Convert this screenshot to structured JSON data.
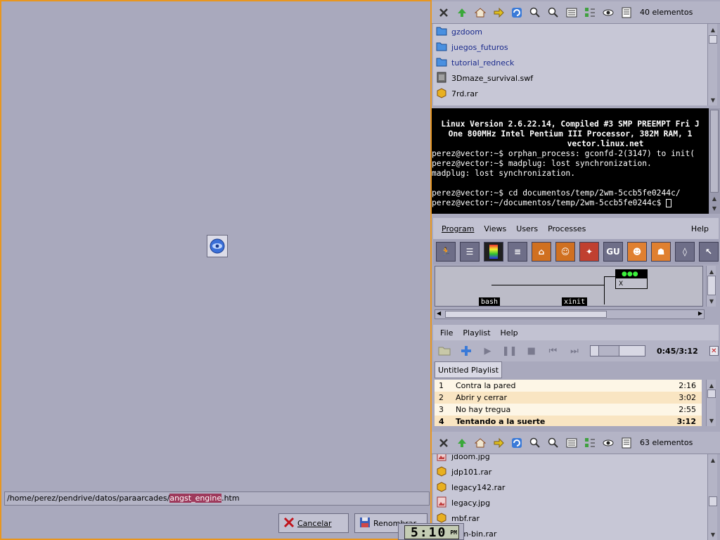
{
  "dialog": {
    "path_prefix": "/home/perez/pendrive/datos/paraarcades/",
    "path_selected": "angst_engine",
    "path_suffix": ".htm",
    "cancel_label": "Cancelar",
    "rename_label": "Renombrar"
  },
  "file_manager_top": {
    "count": "40 elementos",
    "items": [
      {
        "name": "gzdoom",
        "type": "folder"
      },
      {
        "name": "juegos_futuros",
        "type": "folder"
      },
      {
        "name": "tutorial_redneck",
        "type": "folder"
      },
      {
        "name": "3Dmaze_survival.swf",
        "type": "swf"
      },
      {
        "name": "7rd.rar",
        "type": "rar"
      }
    ]
  },
  "terminal": {
    "banner1": "Linux Version 2.6.22.14, Compiled #3 SMP PREEMPT Fri J",
    "banner2": "One 800MHz Intel Pentium III Processor, 382M RAM, 1",
    "banner3": "vector.linux.net",
    "line1": "perez@vector:~$ orphan_process: gconfd-2(3147) to init(",
    "line2": "perez@vector:~$ madplug: lost synchronization.",
    "line3": "madplug: lost synchronization.",
    "line4": "",
    "line5": "perez@vector:~$ cd documentos/temp/2wm-5ccb5fe0244c/",
    "line6": "perez@vector:~/documentos/temp/2wm-5ccb5fe0244c$ "
  },
  "process_viewer": {
    "menu": [
      "Program",
      "Views",
      "Users",
      "Processes"
    ],
    "help": "Help",
    "processes": [
      "bash",
      "xinit",
      "X"
    ]
  },
  "audio_player": {
    "menu": [
      "File",
      "Playlist",
      "Help"
    ],
    "time": "0:45/3:12",
    "seek_fraction": 0.234,
    "playlist_tab": "Untitled Playlist",
    "tracks": [
      {
        "num": "1",
        "title": "Contra la pared",
        "length": "2:16"
      },
      {
        "num": "2",
        "title": "Abrir y cerrar",
        "length": "3:02"
      },
      {
        "num": "3",
        "title": "No hay tregua",
        "length": "2:55"
      },
      {
        "num": "4",
        "title": "Tentando a la suerte",
        "length": "3:12"
      }
    ]
  },
  "file_manager_bottom": {
    "count": "63 elementos",
    "items": [
      {
        "name": "jdoom.jpg",
        "type": "jpg"
      },
      {
        "name": "jdp101.rar",
        "type": "rar"
      },
      {
        "name": "legacy142.rar",
        "type": "rar"
      },
      {
        "name": "legacy.jpg",
        "type": "jpg"
      },
      {
        "name": "mbf.rar",
        "type": "rar"
      },
      {
        "name": "oom-bin.rar",
        "type": "rar"
      }
    ]
  },
  "clock": {
    "time": "5:10",
    "ampm": "PM"
  },
  "colors": {
    "accent_border": "#e8961f",
    "selection": "#9e3a5c",
    "desktop": "#a9a9bd"
  }
}
